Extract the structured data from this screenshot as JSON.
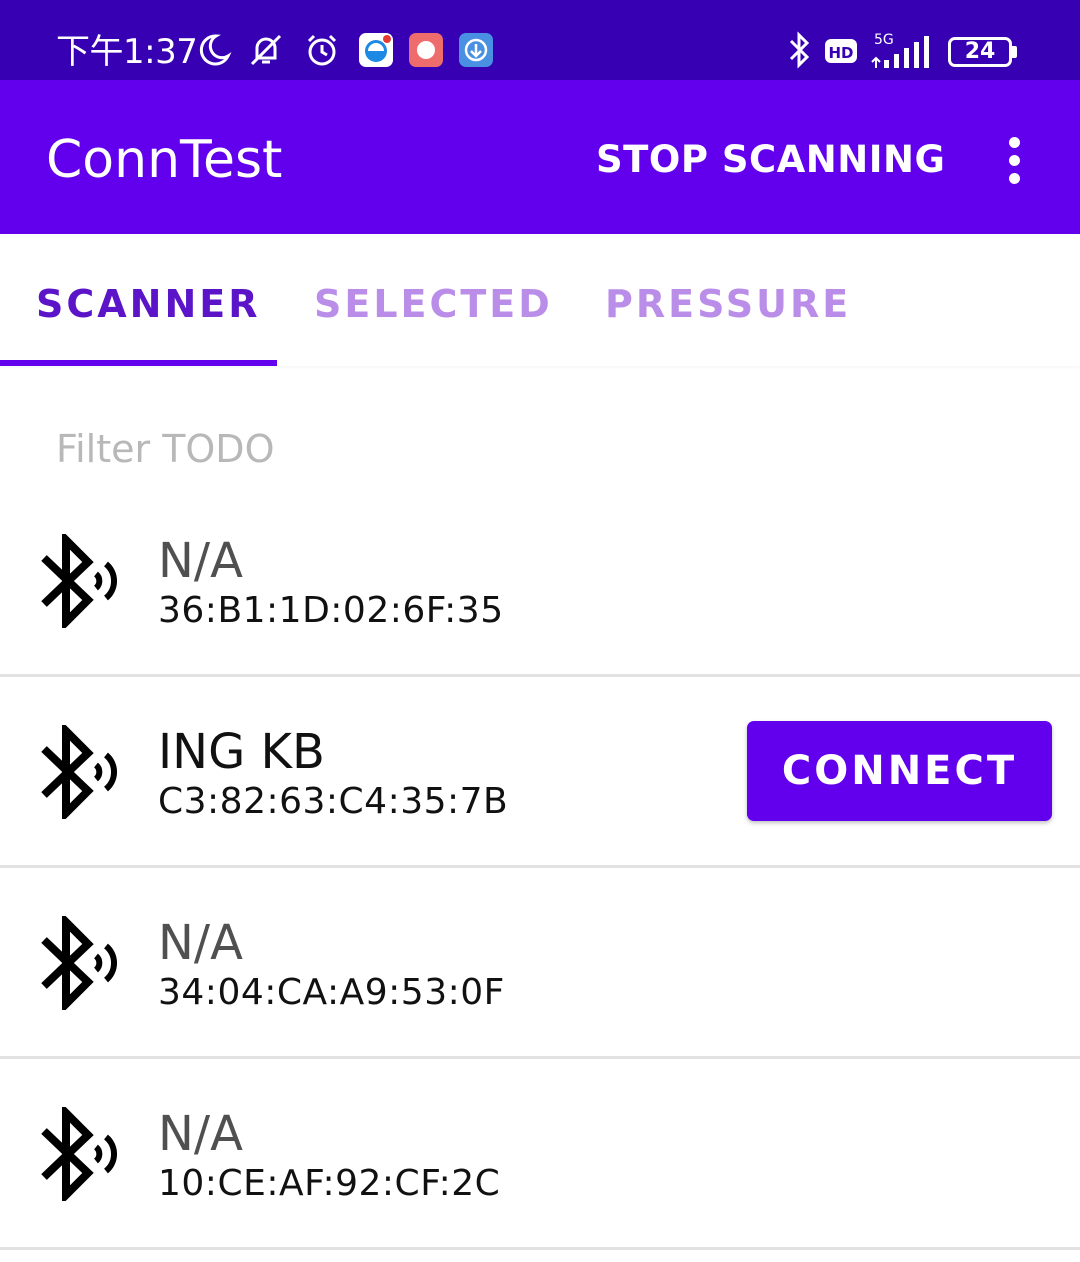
{
  "status_bar": {
    "time": "下午1:37",
    "network": "5G",
    "hd_label": "HD",
    "battery": "24"
  },
  "app_bar": {
    "title": "ConnTest",
    "action_label": "STOP SCANNING"
  },
  "tabs": [
    {
      "label": "SCANNER",
      "active": true
    },
    {
      "label": "SELECTED",
      "active": false
    },
    {
      "label": "PRESSURE",
      "active": false
    }
  ],
  "filter": {
    "placeholder": "Filter TODO",
    "value": ""
  },
  "devices": [
    {
      "name": "N/A",
      "address": "36:B1:1D:02:6F:35"
    },
    {
      "name": "ING KB",
      "address": "C3:82:63:C4:35:7B",
      "action": "CONNECT"
    },
    {
      "name": "N/A",
      "address": "34:04:CA:A9:53:0F"
    },
    {
      "name": "N/A",
      "address": "10:CE:AF:92:CF:2C"
    }
  ],
  "colors": {
    "status_bar": "#3700b3",
    "primary": "#6200ee",
    "tab_active": "#5b14c8",
    "tab_inactive": "#b98de8",
    "divider": "#e2e2e2"
  }
}
